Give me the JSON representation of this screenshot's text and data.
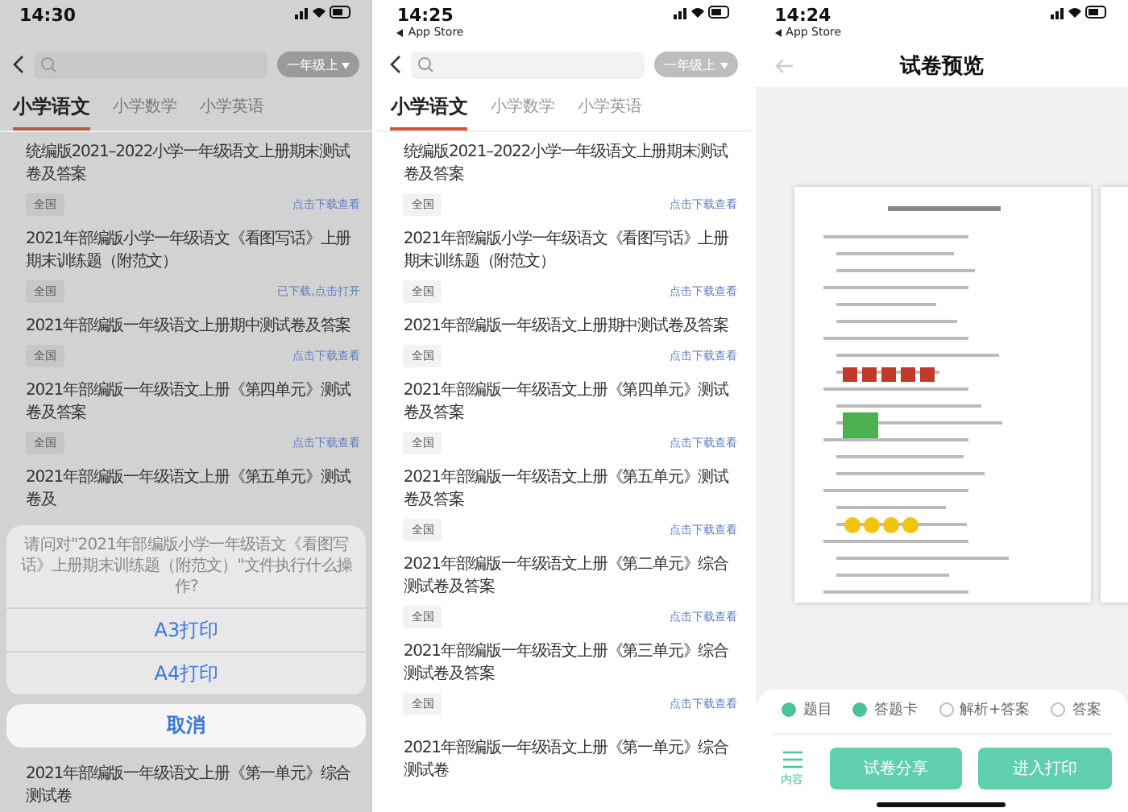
{
  "screens": [
    {
      "kind": "list",
      "dimmed": true,
      "status": {
        "time": "14:30"
      },
      "grade": "一年级上",
      "tabs": [
        {
          "label": "小学语文",
          "selected": true
        },
        {
          "label": "小学数学",
          "selected": false
        },
        {
          "label": "小学英语",
          "selected": false
        }
      ],
      "items": [
        {
          "title": "统编版2021–2022小学一年级语文上册期末测试卷及答案",
          "tag": "全国",
          "action": "点击下载查看"
        },
        {
          "title": "2021年部编版小学一年级语文《看图写话》上册期末训练题（附范文）",
          "tag": "全国",
          "action": "已下载,点击打开"
        },
        {
          "title": "2021年部编版一年级语文上册期中测试卷及答案",
          "tag": "全国",
          "action": "点击下载查看"
        },
        {
          "title": "2021年部编版一年级语文上册《第四单元》测试卷及答案",
          "tag": "全国",
          "action": "点击下载查看"
        },
        {
          "title": "2021年部编版一年级语文上册《第五单元》测试卷及"
        }
      ],
      "action_sheet": {
        "message": "请问对\"2021年部编版小学一年级语文《看图写话》上册期末训练题（附范文）\"文件执行什么操作?",
        "options": [
          "A3打印",
          "A4打印"
        ],
        "cancel": "取消"
      },
      "footer_item": {
        "title": "2021年部编版一年级语文上册《第一单元》综合测试卷"
      }
    },
    {
      "kind": "list",
      "dimmed": false,
      "status": {
        "time": "14:25",
        "back_app": "App Store"
      },
      "grade": "一年级上",
      "tabs": [
        {
          "label": "小学语文",
          "selected": true
        },
        {
          "label": "小学数学",
          "selected": false
        },
        {
          "label": "小学英语",
          "selected": false
        }
      ],
      "items": [
        {
          "title": "统编版2021–2022小学一年级语文上册期末测试卷及答案",
          "tag": "全国",
          "action": "点击下载查看"
        },
        {
          "title": "2021年部编版小学一年级语文《看图写话》上册期末训练题（附范文）",
          "tag": "全国",
          "action": "点击下载查看"
        },
        {
          "title": "2021年部编版一年级语文上册期中测试卷及答案",
          "tag": "全国",
          "action": "点击下载查看"
        },
        {
          "title": "2021年部编版一年级语文上册《第四单元》测试卷及答案",
          "tag": "全国",
          "action": "点击下载查看"
        },
        {
          "title": "2021年部编版一年级语文上册《第五单元》测试卷及答案",
          "tag": "全国",
          "action": "点击下载查看"
        },
        {
          "title": "2021年部编版一年级语文上册《第二单元》综合测试卷及答案",
          "tag": "全国",
          "action": "点击下载查看"
        },
        {
          "title": "2021年部编版一年级语文上册《第三单元》综合测试卷及答案",
          "tag": "全国",
          "action": "点击下载查看"
        }
      ],
      "footer_item": {
        "title": "2021年部编版一年级语文上册《第一单元》综合测试卷"
      }
    },
    {
      "kind": "preview",
      "status": {
        "time": "14:24",
        "back_app": "App Store"
      },
      "title": "试卷预览",
      "options": [
        {
          "label": "题目",
          "checked": true
        },
        {
          "label": "答题卡",
          "checked": true
        },
        {
          "label": "解析+答案",
          "checked": false
        },
        {
          "label": "答案",
          "checked": false
        }
      ],
      "menu_label": "内容",
      "buttons": [
        "试卷分享",
        "进入打印"
      ]
    }
  ]
}
